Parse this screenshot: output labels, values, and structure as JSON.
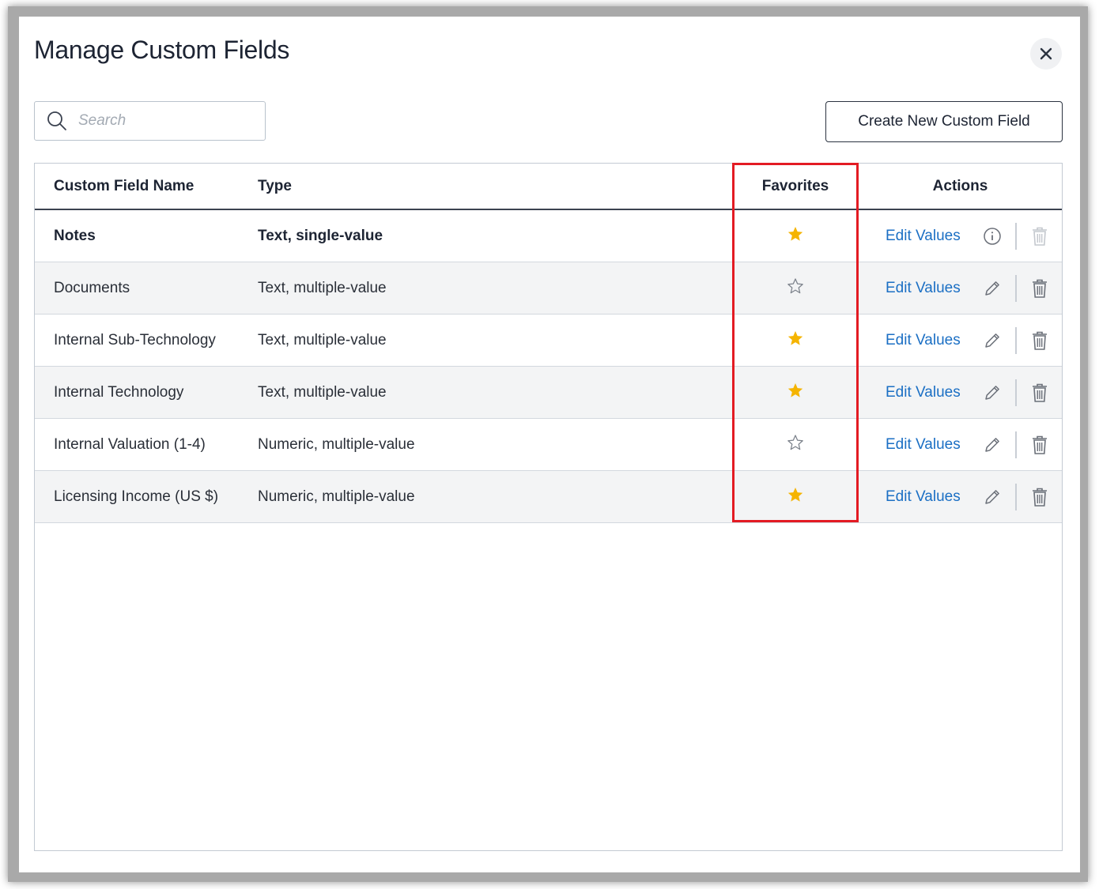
{
  "dialog": {
    "title": "Manage Custom Fields",
    "close_icon": "close-icon"
  },
  "search": {
    "placeholder": "Search",
    "value": "",
    "icon": "search-icon"
  },
  "toolbar": {
    "create_label": "Create New Custom Field"
  },
  "table": {
    "headers": {
      "name": "Custom Field Name",
      "type": "Type",
      "favorites": "Favorites",
      "actions": "Actions"
    },
    "rows": [
      {
        "name": "Notes",
        "type": "Text, single-value",
        "favorite": true,
        "edit_label": "Edit Values",
        "secondary_icon": "info-icon",
        "delete_enabled": false
      },
      {
        "name": "Documents",
        "type": "Text, multiple-value",
        "favorite": false,
        "edit_label": "Edit Values",
        "secondary_icon": "pencil-icon",
        "delete_enabled": true
      },
      {
        "name": "Internal Sub-Technology",
        "type": "Text, multiple-value",
        "favorite": true,
        "edit_label": "Edit Values",
        "secondary_icon": "pencil-icon",
        "delete_enabled": true
      },
      {
        "name": "Internal Technology",
        "type": "Text, multiple-value",
        "favorite": true,
        "edit_label": "Edit Values",
        "secondary_icon": "pencil-icon",
        "delete_enabled": true
      },
      {
        "name": "Internal Valuation (1-4)",
        "type": "Numeric, multiple-value",
        "favorite": false,
        "edit_label": "Edit Values",
        "secondary_icon": "pencil-icon",
        "delete_enabled": true
      },
      {
        "name": "Licensing Income (US $)",
        "type": "Numeric, multiple-value",
        "favorite": true,
        "edit_label": "Edit Values",
        "secondary_icon": "pencil-icon",
        "delete_enabled": true
      }
    ]
  },
  "colors": {
    "star_filled": "#f5b400",
    "star_outline": "#7d838c",
    "link": "#1b6fc4",
    "highlight": "#e31b23"
  }
}
